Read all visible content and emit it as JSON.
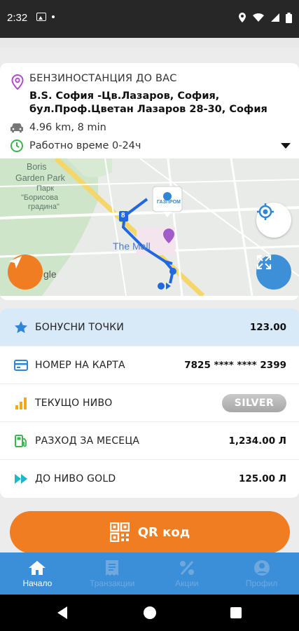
{
  "status_bar": {
    "time": "2:32"
  },
  "station": {
    "section_label": "БЕНЗИНОСТАНЦИЯ ДО ВАС",
    "name_line1": "B.S. София -Цв.Лазаров, София,",
    "name_line2": "бул.Проф.Цветан Лазаров 28-30, София",
    "distance": "4.96 km, 8 min",
    "hours": "Работно време 0-24ч"
  },
  "map": {
    "labels": {
      "park1": "Boris",
      "park2": "Garden Park",
      "park3": "Парк",
      "park4": "\"Борисова",
      "park5": "градина\"",
      "mall": "The Mall",
      "brand": "ГАЗПРОМ",
      "google": "gle",
      "route_marker": "8"
    }
  },
  "stats": {
    "rows": [
      {
        "label": "БОНУСНИ ТОЧКИ",
        "value": "123.00"
      },
      {
        "label": "НОМЕР НА КАРТА",
        "value": "7825 **** **** 2399"
      },
      {
        "label": "ТЕКУЩО НИВО",
        "value": "SILVER"
      },
      {
        "label": "РАЗХОД ЗА МЕСЕЦА",
        "value": "1,234.00 Л"
      },
      {
        "label": "ДО НИВО GOLD",
        "value": "125.00 Л"
      }
    ]
  },
  "qr_button": {
    "label": "QR код"
  },
  "nav": {
    "tabs": [
      {
        "label": "Начало"
      },
      {
        "label": "Транзакции"
      },
      {
        "label": "Акции"
      },
      {
        "label": "Профил"
      }
    ]
  },
  "colors": {
    "accent_orange": "#f17d22",
    "accent_blue": "#3b8fd9",
    "highlight_row": "#d8e9f8",
    "pin_purple": "#b24bd0",
    "clock_green": "#3fb34f"
  },
  "icons": {
    "station_pin": "location-pin-icon",
    "car": "car-icon",
    "clock": "clock-icon",
    "star": "star-icon",
    "card": "credit-card-icon",
    "level": "signal-bars-icon",
    "fuel": "fuel-pump-icon",
    "forward": "fast-forward-icon",
    "qr": "qr-code-icon",
    "home": "home-icon",
    "transactions": "receipt-icon",
    "promotions": "percent-icon",
    "profile": "user-icon"
  }
}
